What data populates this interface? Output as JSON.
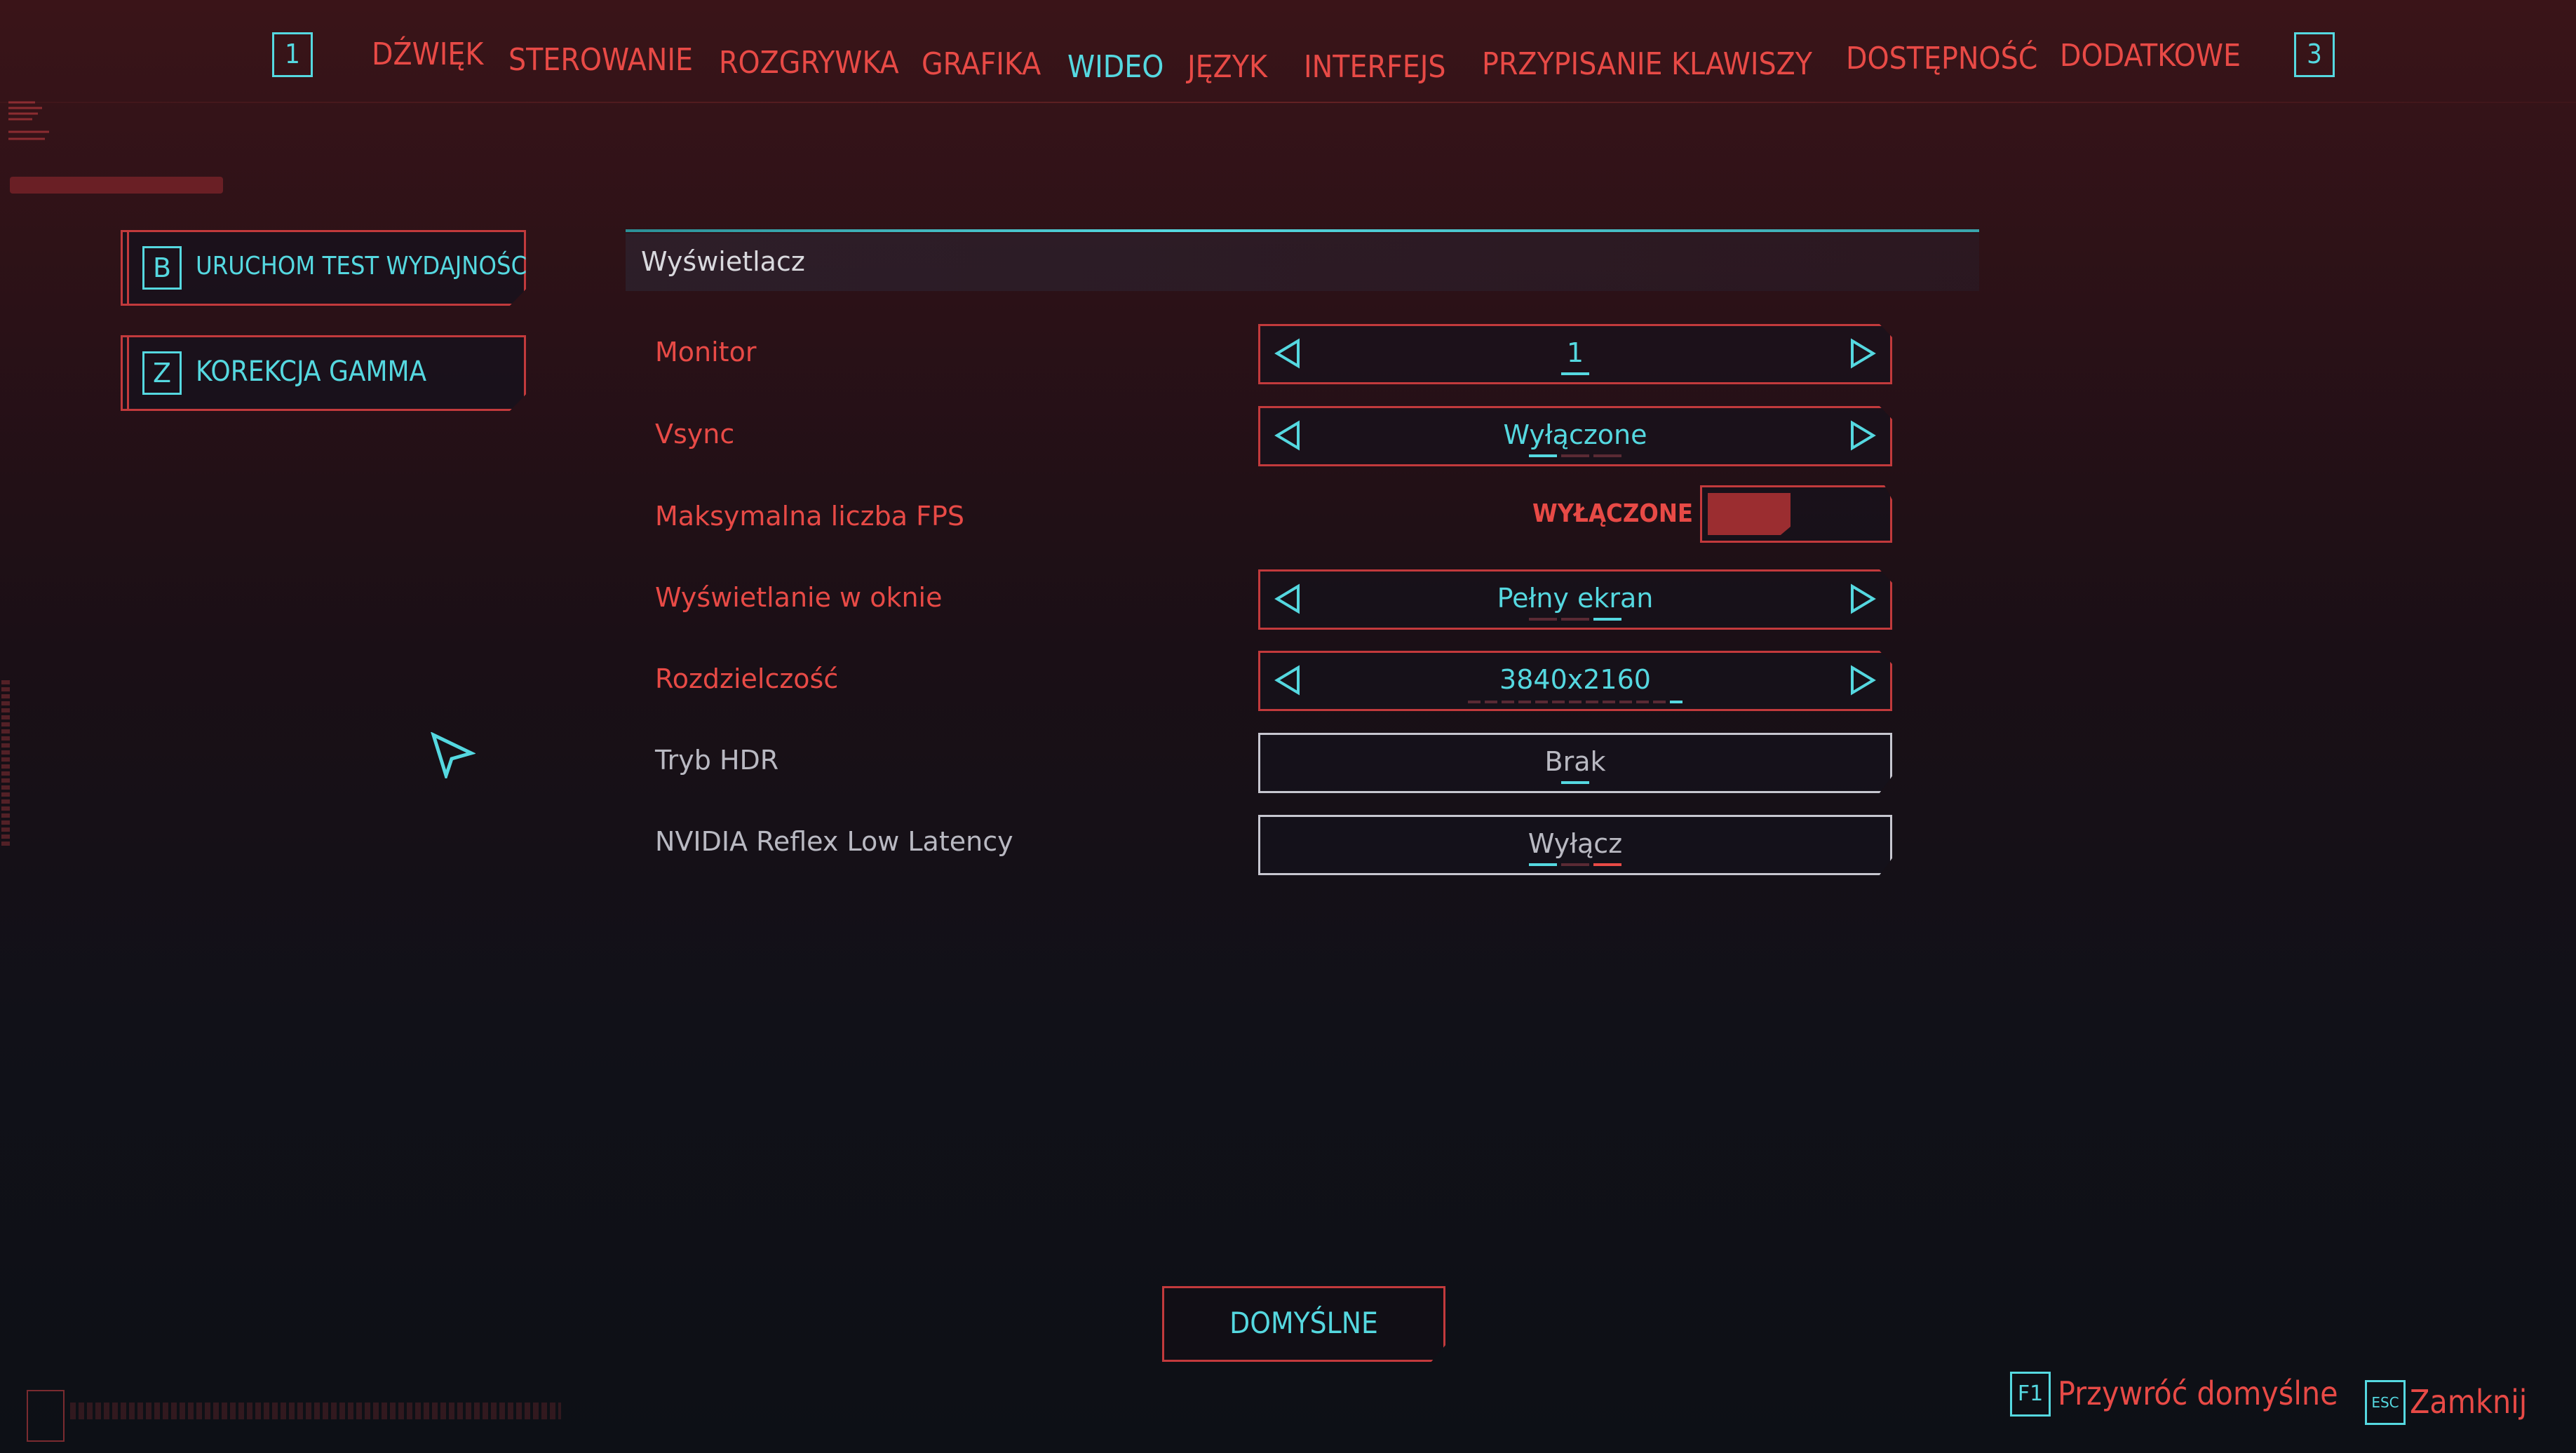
{
  "nav": {
    "left_key": "1",
    "right_key": "3",
    "tabs": [
      {
        "label": "DŹWIĘK",
        "active": false
      },
      {
        "label": "STEROWANIE",
        "active": false
      },
      {
        "label": "ROZGRYWKA",
        "active": false
      },
      {
        "label": "GRAFIKA",
        "active": false
      },
      {
        "label": "WIDEO",
        "active": true
      },
      {
        "label": "JĘZYK",
        "active": false
      },
      {
        "label": "INTERFEJS",
        "active": false
      },
      {
        "label": "PRZYPISANIE KLAWISZY",
        "active": false
      },
      {
        "label": "DOSTĘPNOŚĆ",
        "active": false
      },
      {
        "label": "DODATKOWE",
        "active": false
      }
    ]
  },
  "side": {
    "benchmark": {
      "key": "B",
      "label": "URUCHOM TEST WYDAJNOŚCI"
    },
    "gamma": {
      "key": "Z",
      "label": "KOREKCJA GAMMA"
    }
  },
  "section": {
    "title": "Wyświetlacz"
  },
  "rows": {
    "monitor": {
      "label": "Monitor",
      "value": "1"
    },
    "vsync": {
      "label": "Vsync",
      "value": "Wyłączone"
    },
    "max_fps": {
      "label": "Maksymalna liczba FPS",
      "value": "WYŁĄCZONE",
      "enabled": false
    },
    "window_mode": {
      "label": "Wyświetlanie w oknie",
      "value": "Pełny ekran"
    },
    "resolution": {
      "label": "Rozdzielczość",
      "value": "3840x2160"
    },
    "hdr": {
      "label": "Tryb HDR",
      "value": "Brak"
    },
    "reflex": {
      "label": "NVIDIA Reflex Low Latency",
      "value": "Wyłącz"
    }
  },
  "buttons": {
    "defaults": "DOMYŚLNE"
  },
  "footer": {
    "restore_key": "F1",
    "restore_label": "Przywróć domyślne",
    "close_key": "ESC",
    "close_label": "Zamknij"
  },
  "colors": {
    "accent": "#55d8e0",
    "primary": "#e84a46",
    "muted": "#b9b9c2"
  }
}
